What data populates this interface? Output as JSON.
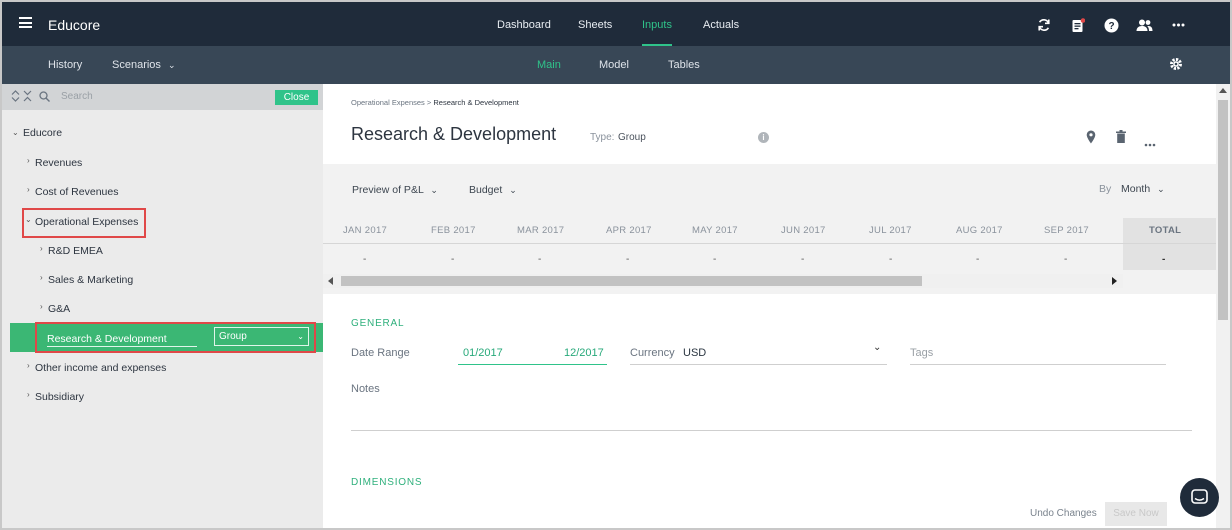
{
  "app": {
    "name": "Educore"
  },
  "top_nav": [
    {
      "label": "Dashboard"
    },
    {
      "label": "Sheets"
    },
    {
      "label": "Inputs",
      "active": true
    },
    {
      "label": "Actuals"
    }
  ],
  "top_icons": [
    "refresh-icon",
    "notes-icon",
    "help-icon",
    "users-icon",
    "more-icon"
  ],
  "sub_nav": {
    "left": [
      {
        "label": "History"
      },
      {
        "label": "Scenarios"
      }
    ],
    "center": [
      {
        "label": "Main",
        "active": true
      },
      {
        "label": "Model"
      },
      {
        "label": "Tables"
      }
    ]
  },
  "sidebar": {
    "search_placeholder": "Search",
    "close_label": "Close",
    "tree": [
      {
        "label": "Educore",
        "level": 0,
        "expanded": true
      },
      {
        "label": "Revenues",
        "level": 1
      },
      {
        "label": "Cost of Revenues",
        "level": 1
      },
      {
        "label": "Operational Expenses",
        "level": 1,
        "expanded": true,
        "highlighted": true
      },
      {
        "label": "R&D EMEA",
        "level": 2
      },
      {
        "label": "Sales & Marketing",
        "level": 2
      },
      {
        "label": "G&A",
        "level": 2
      },
      {
        "label": "Research & Development",
        "level": 2,
        "selected": true,
        "editing": true
      },
      {
        "label": "Other income and expenses",
        "level": 1
      },
      {
        "label": "Subsidiary",
        "level": 1
      }
    ],
    "selected_type_value": "Group"
  },
  "main": {
    "breadcrumb": {
      "parent": "Operational Expenses",
      "separator": ">",
      "current": "Research & Development"
    },
    "title": "Research & Development",
    "type_label": "Type:",
    "type_value": "Group",
    "preview": {
      "view_label": "Preview of P&L",
      "scenario_label": "Budget",
      "by_label": "By",
      "period_label": "Month",
      "months": [
        "JAN 2017",
        "FEB 2017",
        "MAR 2017",
        "APR 2017",
        "MAY 2017",
        "JUN 2017",
        "JUL 2017",
        "AUG 2017",
        "SEP 2017"
      ],
      "values": [
        "-",
        "-",
        "-",
        "-",
        "-",
        "-",
        "-",
        "-",
        "-"
      ],
      "total_header": "TOTAL",
      "total_value": "-"
    },
    "general": {
      "section_label": "GENERAL",
      "date_range_label": "Date Range",
      "date_from": "01/2017",
      "date_to": "12/2017",
      "currency_label": "Currency",
      "currency_value": "USD",
      "tags_placeholder": "Tags",
      "notes_label": "Notes"
    },
    "dimensions": {
      "section_label": "DIMENSIONS"
    }
  },
  "footer": {
    "undo_label": "Undo Changes",
    "save_label": "Save Now"
  },
  "colors": {
    "accent": "#2fc38a",
    "topbar": "#1f2b3a",
    "subbar": "#384756",
    "highlight": "#e04848"
  }
}
